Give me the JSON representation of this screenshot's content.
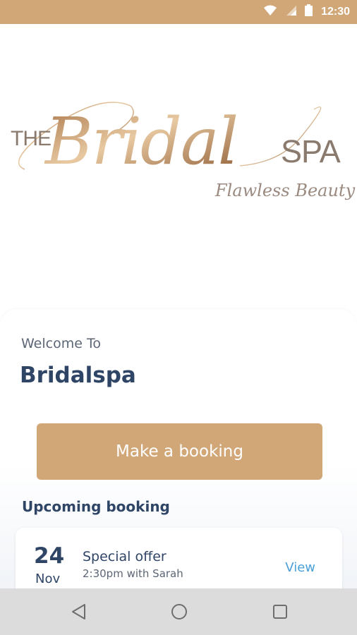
{
  "status_bar": {
    "time": "12:30",
    "icons": [
      "wifi-icon",
      "signal-icon",
      "battery-icon"
    ],
    "color": "#d1a778"
  },
  "logo": {
    "the": "THE",
    "bridal": "Bridal",
    "spa": "SPA",
    "tagline": "Flawless Beauty"
  },
  "welcome": {
    "subtitle": "Welcome To",
    "name": "Bridalspa"
  },
  "actions": {
    "book_label": "Make a booking"
  },
  "upcoming": {
    "title": "Upcoming booking",
    "booking": {
      "day": "24",
      "month": "Nov",
      "title": "Special offer",
      "detail": "2:30pm with Sarah",
      "view_label": "View"
    }
  },
  "nav_bar": {
    "buttons": [
      "back-icon",
      "home-icon",
      "recents-icon"
    ]
  },
  "colors": {
    "accent": "#d1a778",
    "heading": "#2f4566",
    "link": "#4a9fd8"
  }
}
